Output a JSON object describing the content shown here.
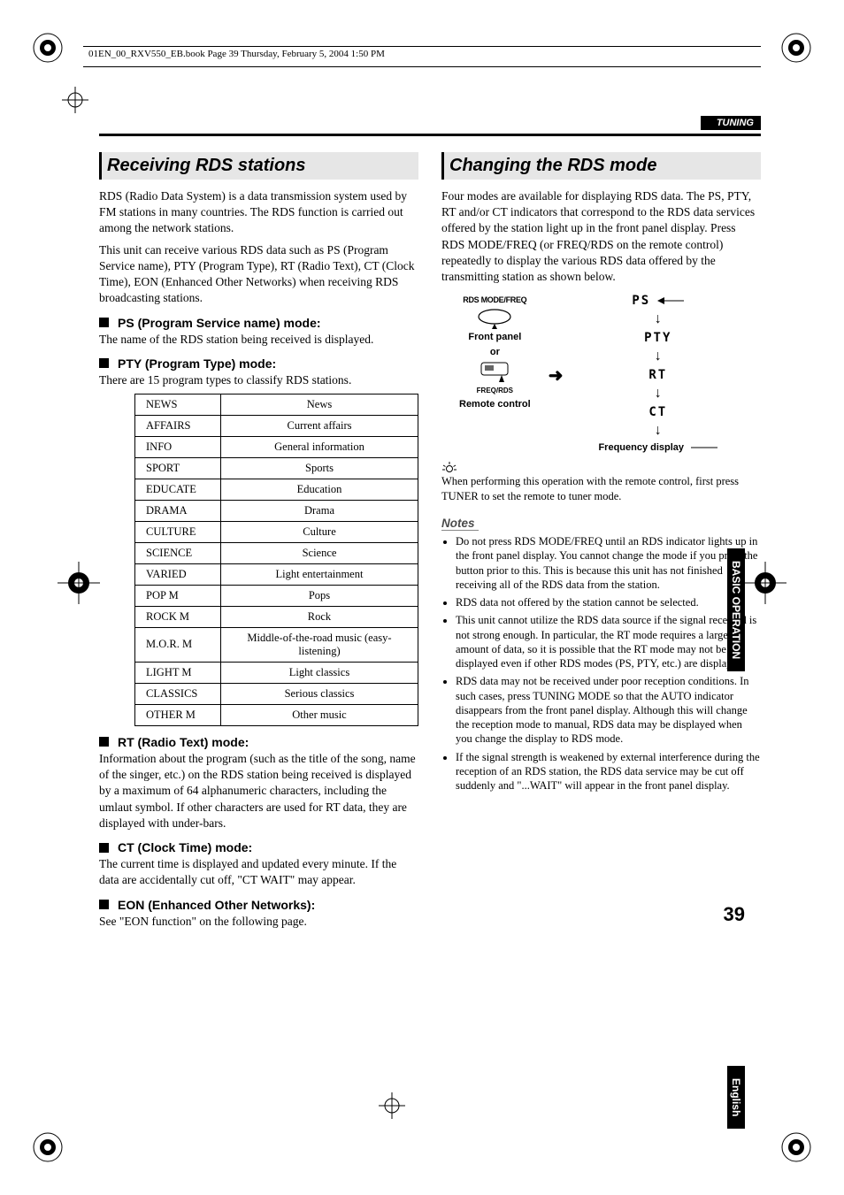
{
  "meta_header": "01EN_00_RXV550_EB.book  Page 39  Thursday, February 5, 2004  1:50 PM",
  "section_label": "TUNING",
  "side_tab": "BASIC OPERATION",
  "side_tab2": "English",
  "page_number": "39",
  "left": {
    "h": "Receiving RDS stations",
    "p1": "RDS (Radio Data System) is a data transmission system used by FM stations in many countries. The RDS function is carried out among the network stations.",
    "p2": "This unit can receive various RDS data such as PS (Program Service name), PTY (Program Type), RT (Radio Text), CT (Clock Time), EON (Enhanced Other Networks) when receiving RDS broadcasting stations.",
    "ps_h": "PS (Program Service name) mode:",
    "ps_t": "The name of the RDS station being received is displayed.",
    "pty_h": "PTY (Program Type) mode:",
    "pty_t": "There are 15 program types to classify RDS stations.",
    "pty_table": [
      [
        "NEWS",
        "News"
      ],
      [
        "AFFAIRS",
        "Current affairs"
      ],
      [
        "INFO",
        "General information"
      ],
      [
        "SPORT",
        "Sports"
      ],
      [
        "EDUCATE",
        "Education"
      ],
      [
        "DRAMA",
        "Drama"
      ],
      [
        "CULTURE",
        "Culture"
      ],
      [
        "SCIENCE",
        "Science"
      ],
      [
        "VARIED",
        "Light entertainment"
      ],
      [
        "POP M",
        "Pops"
      ],
      [
        "ROCK M",
        "Rock"
      ],
      [
        "M.O.R. M",
        "Middle-of-the-road music (easy-listening)"
      ],
      [
        "LIGHT M",
        "Light classics"
      ],
      [
        "CLASSICS",
        "Serious classics"
      ],
      [
        "OTHER M",
        "Other music"
      ]
    ],
    "rt_h": "RT (Radio Text) mode:",
    "rt_t": "Information about the program (such as the title of the song, name of the singer, etc.) on the RDS station being received is displayed by a maximum of 64 alphanumeric characters, including the umlaut symbol. If other characters are used for RT data, they are displayed with under-bars.",
    "ct_h": "CT (Clock Time) mode:",
    "ct_t": "The current time is displayed and updated every minute. If the data are accidentally cut off, \"CT WAIT\" may appear.",
    "eon_h": "EON (Enhanced Other Networks):",
    "eon_t": "See \"EON function\" on the following page."
  },
  "right": {
    "h": "Changing the RDS mode",
    "p1": "Four modes are available for displaying RDS data. The PS, PTY, RT and/or CT indicators that correspond to the RDS data services offered by the station light up in the front panel display. Press RDS MODE/FREQ (or FREQ/RDS on the remote control) repeatedly to display the various RDS data offered by the transmitting station as shown below.",
    "diagram": {
      "btn_label": "RDS MODE/FREQ",
      "front_panel": "Front panel",
      "or": "or",
      "remote_btn": "FREQ/RDS",
      "remote": "Remote control",
      "seq": [
        "PS",
        "PTY",
        "RT",
        "CT"
      ],
      "freq": "Frequency display"
    },
    "tip": "When performing this operation with the remote control, first press TUNER to set the remote to tuner mode.",
    "notes_h": "Notes",
    "notes": [
      "Do not press RDS MODE/FREQ until an RDS indicator lights up in the front panel display. You cannot change the mode if you press the button prior to this. This is because this unit has not finished receiving all of the RDS data from the station.",
      "RDS data not offered by the station cannot be selected.",
      "This unit cannot utilize the RDS data source if the signal received is not strong enough. In particular, the RT mode requires a large amount of data, so it is possible that the RT mode may not be displayed even if other RDS modes (PS, PTY, etc.) are displayed.",
      "RDS data may not be received under poor reception conditions. In such cases, press TUNING MODE so that the AUTO indicator disappears from the front panel display. Although this will change the reception mode to manual, RDS data may be displayed when you change the display to RDS mode.",
      "If the signal strength is weakened by external interference during the reception of an RDS station, the RDS data service may be cut off suddenly and \"...WAIT\" will appear in the front panel display."
    ]
  }
}
